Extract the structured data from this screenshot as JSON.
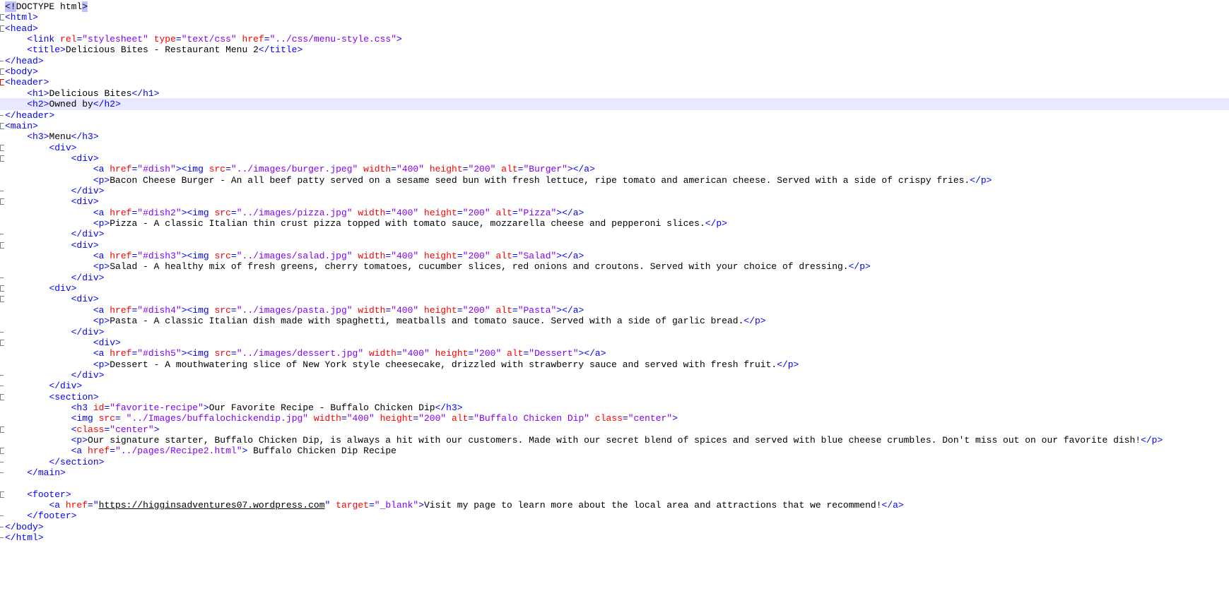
{
  "lines": [
    {
      "t": [
        [
          "sel",
          "<!"
        ],
        [
          "tx",
          "DOCTYPE html"
        ],
        [
          "sel",
          ">"
        ]
      ],
      "m": ""
    },
    {
      "t": [
        [
          "t",
          "<html>"
        ]
      ],
      "m": "open"
    },
    {
      "t": [
        [
          "t",
          "<head>"
        ]
      ],
      "m": "open"
    },
    {
      "t": [
        [
          "tx",
          "    "
        ],
        [
          "t",
          "<link "
        ],
        [
          "an",
          "rel"
        ],
        [
          "t",
          "="
        ],
        [
          "av",
          "\"stylesheet\""
        ],
        [
          "tx",
          " "
        ],
        [
          "an",
          "type"
        ],
        [
          "t",
          "="
        ],
        [
          "av",
          "\"text/css\""
        ],
        [
          "tx",
          " "
        ],
        [
          "an",
          "href"
        ],
        [
          "t",
          "="
        ],
        [
          "av",
          "\"../css/menu-style.css\""
        ],
        [
          "t",
          ">"
        ]
      ],
      "m": ""
    },
    {
      "t": [
        [
          "tx",
          "    "
        ],
        [
          "t",
          "<title>"
        ],
        [
          "tx",
          "Delicious Bites - Restaurant Menu 2"
        ],
        [
          "t",
          "</title>"
        ]
      ],
      "m": ""
    },
    {
      "t": [
        [
          "t",
          "</head>"
        ]
      ],
      "m": "end"
    },
    {
      "t": [
        [
          "t",
          "<body>"
        ]
      ],
      "m": "open"
    },
    {
      "t": [
        [
          "t",
          "<header>"
        ]
      ],
      "m": "open-red"
    },
    {
      "t": [
        [
          "tx",
          "    "
        ],
        [
          "t",
          "<h1>"
        ],
        [
          "tx",
          "Delicious Bites"
        ],
        [
          "t",
          "</h1>"
        ]
      ],
      "m": ""
    },
    {
      "t": [
        [
          "tx",
          "    "
        ],
        [
          "t",
          "<h2>"
        ],
        [
          "tx",
          "Owned by"
        ],
        [
          "t",
          "</h2>"
        ]
      ],
      "m": "",
      "current": true
    },
    {
      "t": [
        [
          "t",
          "</header>"
        ]
      ],
      "m": "end"
    },
    {
      "t": [
        [
          "t",
          "<main>"
        ]
      ],
      "m": "open"
    },
    {
      "t": [
        [
          "tx",
          "    "
        ],
        [
          "t",
          "<h3>"
        ],
        [
          "tx",
          "Menu"
        ],
        [
          "t",
          "</h3>"
        ]
      ],
      "m": ""
    },
    {
      "t": [
        [
          "tx",
          "        "
        ],
        [
          "t",
          "<div>"
        ]
      ],
      "m": "open"
    },
    {
      "t": [
        [
          "tx",
          "            "
        ],
        [
          "t",
          "<div>"
        ]
      ],
      "m": "open"
    },
    {
      "t": [
        [
          "tx",
          "                "
        ],
        [
          "t",
          "<a "
        ],
        [
          "an",
          "href"
        ],
        [
          "t",
          "="
        ],
        [
          "av",
          "\"#dish\""
        ],
        [
          "t",
          "><img "
        ],
        [
          "an",
          "src"
        ],
        [
          "t",
          "="
        ],
        [
          "av",
          "\"../images/burger.jpeg\""
        ],
        [
          "tx",
          " "
        ],
        [
          "an",
          "width"
        ],
        [
          "t",
          "="
        ],
        [
          "av",
          "\"400\""
        ],
        [
          "tx",
          " "
        ],
        [
          "an",
          "height"
        ],
        [
          "t",
          "="
        ],
        [
          "av",
          "\"200\""
        ],
        [
          "tx",
          " "
        ],
        [
          "an",
          "alt"
        ],
        [
          "t",
          "="
        ],
        [
          "av",
          "\"Burger\""
        ],
        [
          "t",
          "></a>"
        ]
      ],
      "m": ""
    },
    {
      "t": [
        [
          "tx",
          "                "
        ],
        [
          "t",
          "<p>"
        ],
        [
          "tx",
          "Bacon Cheese Burger - An all beef patty served on a sesame seed bun with fresh lettuce, ripe tomato and american cheese. Served with a side of crispy fries."
        ],
        [
          "t",
          "</p>"
        ]
      ],
      "m": ""
    },
    {
      "t": [
        [
          "tx",
          "            "
        ],
        [
          "t",
          "</div>"
        ]
      ],
      "m": "end"
    },
    {
      "t": [
        [
          "tx",
          "            "
        ],
        [
          "t",
          "<div>"
        ]
      ],
      "m": "open"
    },
    {
      "t": [
        [
          "tx",
          "                "
        ],
        [
          "t",
          "<a "
        ],
        [
          "an",
          "href"
        ],
        [
          "t",
          "="
        ],
        [
          "av",
          "\"#dish2\""
        ],
        [
          "t",
          "><img "
        ],
        [
          "an",
          "src"
        ],
        [
          "t",
          "="
        ],
        [
          "av",
          "\"../images/pizza.jpg\""
        ],
        [
          "tx",
          " "
        ],
        [
          "an",
          "width"
        ],
        [
          "t",
          "="
        ],
        [
          "av",
          "\"400\""
        ],
        [
          "tx",
          " "
        ],
        [
          "an",
          "height"
        ],
        [
          "t",
          "="
        ],
        [
          "av",
          "\"200\""
        ],
        [
          "tx",
          " "
        ],
        [
          "an",
          "alt"
        ],
        [
          "t",
          "="
        ],
        [
          "av",
          "\"Pizza\""
        ],
        [
          "t",
          "></a>"
        ]
      ],
      "m": ""
    },
    {
      "t": [
        [
          "tx",
          "                "
        ],
        [
          "t",
          "<p>"
        ],
        [
          "tx",
          "Pizza - A classic Italian thin crust pizza topped with tomato sauce, mozzarella cheese and pepperoni slices."
        ],
        [
          "t",
          "</p>"
        ]
      ],
      "m": ""
    },
    {
      "t": [
        [
          "tx",
          "            "
        ],
        [
          "t",
          "</div>"
        ]
      ],
      "m": "end"
    },
    {
      "t": [
        [
          "tx",
          "            "
        ],
        [
          "t",
          "<div>"
        ]
      ],
      "m": "open"
    },
    {
      "t": [
        [
          "tx",
          "                "
        ],
        [
          "t",
          "<a "
        ],
        [
          "an",
          "href"
        ],
        [
          "t",
          "="
        ],
        [
          "av",
          "\"#dish3\""
        ],
        [
          "t",
          "><img "
        ],
        [
          "an",
          "src"
        ],
        [
          "t",
          "="
        ],
        [
          "av",
          "\"../images/salad.jpg\""
        ],
        [
          "tx",
          " "
        ],
        [
          "an",
          "width"
        ],
        [
          "t",
          "="
        ],
        [
          "av",
          "\"400\""
        ],
        [
          "tx",
          " "
        ],
        [
          "an",
          "height"
        ],
        [
          "t",
          "="
        ],
        [
          "av",
          "\"200\""
        ],
        [
          "tx",
          " "
        ],
        [
          "an",
          "alt"
        ],
        [
          "t",
          "="
        ],
        [
          "av",
          "\"Salad\""
        ],
        [
          "t",
          "></a>"
        ]
      ],
      "m": ""
    },
    {
      "t": [
        [
          "tx",
          "                "
        ],
        [
          "t",
          "<p>"
        ],
        [
          "tx",
          "Salad - A healthy mix of fresh greens, cherry tomatoes, cucumber slices, red onions and croutons. Served with your choice of dressing."
        ],
        [
          "t",
          "</p>"
        ]
      ],
      "m": ""
    },
    {
      "t": [
        [
          "tx",
          "            "
        ],
        [
          "t",
          "</div>"
        ]
      ],
      "m": "end"
    },
    {
      "t": [
        [
          "tx",
          "        "
        ],
        [
          "t",
          "<div>"
        ]
      ],
      "m": "open"
    },
    {
      "t": [
        [
          "tx",
          "            "
        ],
        [
          "t",
          "<div>"
        ]
      ],
      "m": "open"
    },
    {
      "t": [
        [
          "tx",
          "                "
        ],
        [
          "t",
          "<a "
        ],
        [
          "an",
          "href"
        ],
        [
          "t",
          "="
        ],
        [
          "av",
          "\"#dish4\""
        ],
        [
          "t",
          "><img "
        ],
        [
          "an",
          "src"
        ],
        [
          "t",
          "="
        ],
        [
          "av",
          "\"../images/pasta.jpg\""
        ],
        [
          "tx",
          " "
        ],
        [
          "an",
          "width"
        ],
        [
          "t",
          "="
        ],
        [
          "av",
          "\"400\""
        ],
        [
          "tx",
          " "
        ],
        [
          "an",
          "height"
        ],
        [
          "t",
          "="
        ],
        [
          "av",
          "\"200\""
        ],
        [
          "tx",
          " "
        ],
        [
          "an",
          "alt"
        ],
        [
          "t",
          "="
        ],
        [
          "av",
          "\"Pasta\""
        ],
        [
          "t",
          "></a>"
        ]
      ],
      "m": ""
    },
    {
      "t": [
        [
          "tx",
          "                "
        ],
        [
          "t",
          "<p>"
        ],
        [
          "tx",
          "Pasta - A classic Italian dish made with spaghetti, meatballs and tomato sauce. Served with a side of garlic bread."
        ],
        [
          "t",
          "</p>"
        ]
      ],
      "m": ""
    },
    {
      "t": [
        [
          "tx",
          "            "
        ],
        [
          "t",
          "</div>"
        ]
      ],
      "m": "end"
    },
    {
      "t": [
        [
          "tx",
          "                "
        ],
        [
          "t",
          "<div>"
        ]
      ],
      "m": "open"
    },
    {
      "t": [
        [
          "tx",
          "                "
        ],
        [
          "t",
          "<a "
        ],
        [
          "an",
          "href"
        ],
        [
          "t",
          "="
        ],
        [
          "av",
          "\"#dish5\""
        ],
        [
          "t",
          "><img "
        ],
        [
          "an",
          "src"
        ],
        [
          "t",
          "="
        ],
        [
          "av",
          "\"../images/dessert.jpg\""
        ],
        [
          "tx",
          " "
        ],
        [
          "an",
          "width"
        ],
        [
          "t",
          "="
        ],
        [
          "av",
          "\"400\""
        ],
        [
          "tx",
          " "
        ],
        [
          "an",
          "height"
        ],
        [
          "t",
          "="
        ],
        [
          "av",
          "\"200\""
        ],
        [
          "tx",
          " "
        ],
        [
          "an",
          "alt"
        ],
        [
          "t",
          "="
        ],
        [
          "av",
          "\"Dessert\""
        ],
        [
          "t",
          "></a>"
        ]
      ],
      "m": ""
    },
    {
      "t": [
        [
          "tx",
          "                "
        ],
        [
          "t",
          "<p>"
        ],
        [
          "tx",
          "Dessert - A mouthwatering slice of New York style cheesecake, drizzled with strawberry sauce and served with fresh fruit."
        ],
        [
          "t",
          "</p>"
        ]
      ],
      "m": ""
    },
    {
      "t": [
        [
          "tx",
          "            "
        ],
        [
          "t",
          "</div>"
        ]
      ],
      "m": "end"
    },
    {
      "t": [
        [
          "tx",
          "        "
        ],
        [
          "t",
          "</div>"
        ]
      ],
      "m": "end"
    },
    {
      "t": [
        [
          "tx",
          "        "
        ],
        [
          "t",
          "<section>"
        ]
      ],
      "m": "open"
    },
    {
      "t": [
        [
          "tx",
          "            "
        ],
        [
          "t",
          "<h3 "
        ],
        [
          "an",
          "id"
        ],
        [
          "t",
          "="
        ],
        [
          "av",
          "\"favorite-recipe\""
        ],
        [
          "t",
          ">"
        ],
        [
          "tx",
          "Our Favorite Recipe - Buffalo Chicken Dip"
        ],
        [
          "t",
          "</h3>"
        ]
      ],
      "m": ""
    },
    {
      "t": [
        [
          "tx",
          "            "
        ],
        [
          "t",
          "<img "
        ],
        [
          "an",
          "src"
        ],
        [
          "t",
          "= "
        ],
        [
          "av",
          "\"../Images/buffalochickendip.jpg\""
        ],
        [
          "tx",
          " "
        ],
        [
          "an",
          "width"
        ],
        [
          "t",
          "="
        ],
        [
          "av",
          "\"400\""
        ],
        [
          "tx",
          " "
        ],
        [
          "an",
          "height"
        ],
        [
          "t",
          "="
        ],
        [
          "av",
          "\"200\""
        ],
        [
          "tx",
          " "
        ],
        [
          "an",
          "alt"
        ],
        [
          "t",
          "="
        ],
        [
          "av",
          "\"Buffalo Chicken Dip\""
        ],
        [
          "tx",
          " "
        ],
        [
          "an",
          "class"
        ],
        [
          "t",
          "="
        ],
        [
          "av",
          "\"center\""
        ],
        [
          "t",
          ">"
        ]
      ],
      "m": ""
    },
    {
      "t": [
        [
          "tx",
          "            "
        ],
        [
          "t",
          "<"
        ],
        [
          "an",
          "class"
        ],
        [
          "t",
          "="
        ],
        [
          "av",
          "\"center\""
        ],
        [
          "t",
          ">"
        ]
      ],
      "m": "open"
    },
    {
      "t": [
        [
          "tx",
          "            "
        ],
        [
          "t",
          "<p>"
        ],
        [
          "tx",
          "Our signature starter, Buffalo Chicken Dip, is always a hit with our customers. Made with our secret blend of spices and served with blue cheese crumbles. Don't miss out on our favorite dish!"
        ],
        [
          "t",
          "</p>"
        ]
      ],
      "m": ""
    },
    {
      "t": [
        [
          "tx",
          "            "
        ],
        [
          "t",
          "<a "
        ],
        [
          "an",
          "href"
        ],
        [
          "t",
          "="
        ],
        [
          "av",
          "\"../pages/Recipe2.html\""
        ],
        [
          "t",
          ">"
        ],
        [
          "tx",
          " Buffalo Chicken Dip Recipe"
        ]
      ],
      "m": "open"
    },
    {
      "t": [
        [
          "tx",
          "        "
        ],
        [
          "t",
          "</section>"
        ]
      ],
      "m": "end"
    },
    {
      "t": [
        [
          "tx",
          "    "
        ],
        [
          "t",
          "</main>"
        ]
      ],
      "m": "end"
    },
    {
      "t": [],
      "m": ""
    },
    {
      "t": [
        [
          "tx",
          "    "
        ],
        [
          "t",
          "<footer>"
        ]
      ],
      "m": "open"
    },
    {
      "t": [
        [
          "tx",
          "        "
        ],
        [
          "t",
          "<a "
        ],
        [
          "an",
          "href"
        ],
        [
          "t",
          "=\""
        ],
        [
          "u",
          "https://higginsadventures07.wordpress.com"
        ],
        [
          "t",
          "\""
        ],
        [
          "tx",
          " "
        ],
        [
          "an",
          "target"
        ],
        [
          "t",
          "="
        ],
        [
          "av",
          "\"_blank\""
        ],
        [
          "t",
          ">"
        ],
        [
          "tx",
          "Visit my page to learn more about the local area and attractions that we recommend!"
        ],
        [
          "t",
          "</a>"
        ]
      ],
      "m": ""
    },
    {
      "t": [
        [
          "tx",
          "    "
        ],
        [
          "t",
          "</footer>"
        ]
      ],
      "m": "end"
    },
    {
      "t": [
        [
          "t",
          "</body>"
        ]
      ],
      "m": "end"
    },
    {
      "t": [
        [
          "t",
          "</html>"
        ]
      ],
      "m": "end"
    }
  ]
}
